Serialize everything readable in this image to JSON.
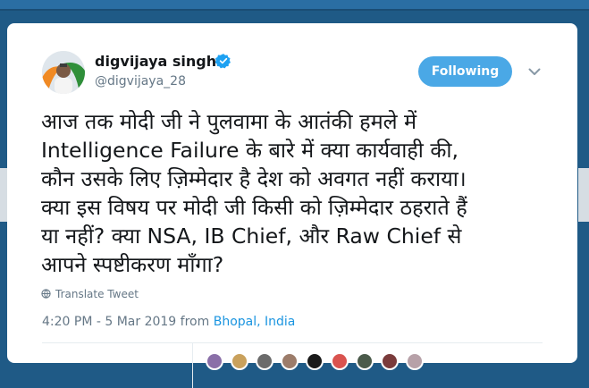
{
  "tweet": {
    "author_name": "digvijaya singh",
    "handle": "@digvijaya_28",
    "follow_label": "Following",
    "text": "आज तक मोदी जी ने पुलवामा के आतंकी हमले में\nIntelligence Failure के बारे में क्या कार्यवाही की,\nकौन उसके लिए ज़िम्मेदार है देश को अवगत नहीं कराया।\nक्या इस विषय पर मोदी जी किसी को ज़िम्मेदार ठहराते हैं\nया नहीं? क्या NSA, IB Chief, और  Raw Chief से\nआपने स्पष्टीकरण माँगा?",
    "translate_label": "Translate Tweet",
    "timestamp": "4:20 PM - 5 Mar 2019",
    "from_label": "from",
    "location": "Bhopal, India"
  },
  "colors": {
    "follow_button": "#4aa8e6",
    "link": "#1b95e0",
    "verified": "#1da1f2",
    "secondary_text": "#657786"
  },
  "icons": {
    "verified": "verified-badge-icon",
    "caret": "chevron-down-icon",
    "translate": "globe-icon"
  }
}
